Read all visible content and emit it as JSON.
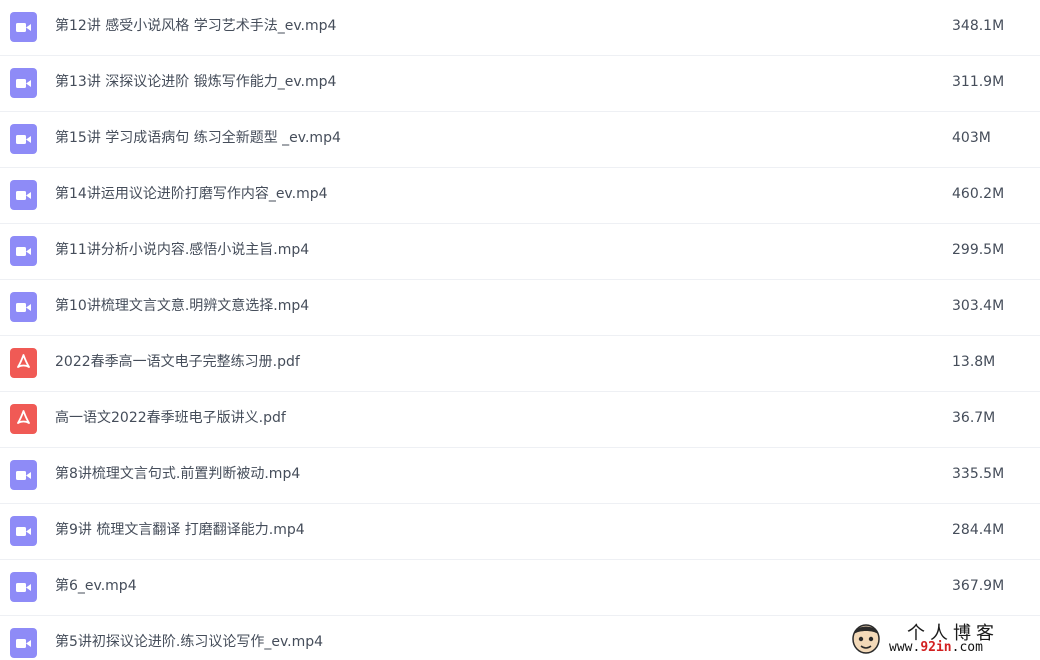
{
  "colors": {
    "video_icon": "#8e8bf7",
    "pdf_icon": "#f05a55",
    "text": "#454d5a",
    "row_divider": "#eef0f4"
  },
  "files": [
    {
      "name": "第12讲 感受小说风格 学习艺术手法_ev.mp4",
      "size": "348.1M",
      "type": "video",
      "icon": "video-icon"
    },
    {
      "name": "第13讲 深探议论进阶 锻炼写作能力_ev.mp4",
      "size": "311.9M",
      "type": "video",
      "icon": "video-icon"
    },
    {
      "name": "第15讲 学习成语病句 练习全新题型 _ev.mp4",
      "size": "403M",
      "type": "video",
      "icon": "video-icon"
    },
    {
      "name": "第14讲运用议论进阶打磨写作内容_ev.mp4",
      "size": "460.2M",
      "type": "video",
      "icon": "video-icon"
    },
    {
      "name": "第11讲分析小说内容.感悟小说主旨.mp4",
      "size": "299.5M",
      "type": "video",
      "icon": "video-icon"
    },
    {
      "name": "第10讲梳理文言文意.明辨文意选择.mp4",
      "size": "303.4M",
      "type": "video",
      "icon": "video-icon"
    },
    {
      "name": "2022春季高一语文电子完整练习册.pdf",
      "size": "13.8M",
      "type": "pdf",
      "icon": "pdf-icon"
    },
    {
      "name": "高一语文2022春季班电子版讲义.pdf",
      "size": "36.7M",
      "type": "pdf",
      "icon": "pdf-icon"
    },
    {
      "name": "第8讲梳理文言句式.前置判断被动.mp4",
      "size": "335.5M",
      "type": "video",
      "icon": "video-icon"
    },
    {
      "name": "第9讲 梳理文言翻译 打磨翻译能力.mp4",
      "size": "284.4M",
      "type": "video",
      "icon": "video-icon"
    },
    {
      "name": "第6_ev.mp4",
      "size": "367.9M",
      "type": "video",
      "icon": "video-icon"
    },
    {
      "name": "第5讲初探议论进阶.练习议论写作_ev.mp4",
      "size": "",
      "type": "video",
      "icon": "video-icon"
    }
  ],
  "watermark": {
    "title": "个人博客",
    "url_prefix": "www.",
    "url_highlight": "92in",
    "url_suffix": ".com",
    "icon": "cartoon-avatar-icon"
  }
}
